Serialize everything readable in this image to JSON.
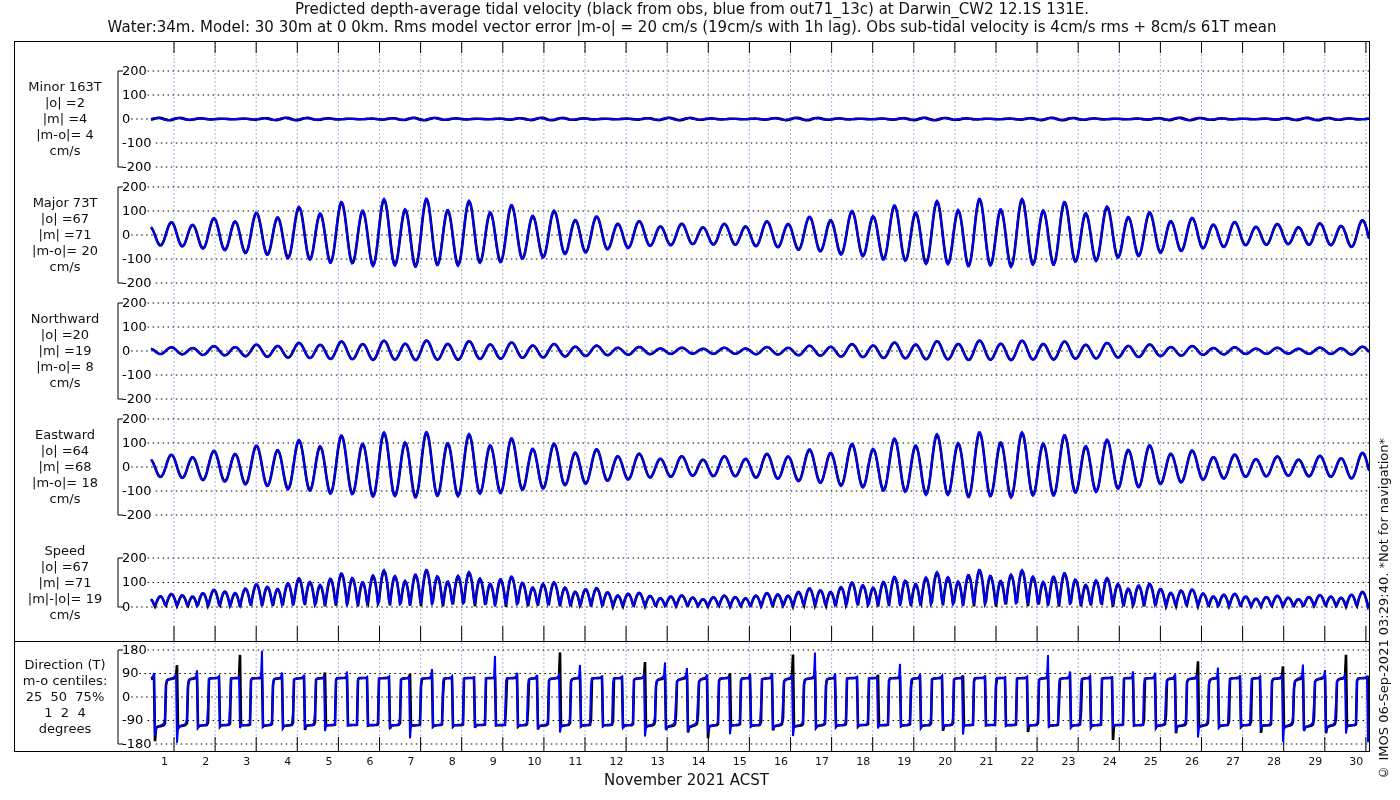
{
  "title": [
    "Predicted depth-average tidal velocity (black from obs, blue from out71_13c) at Darwin_CW2 12.1S 131E.",
    "Water:34m. Model: 30 30m at 0 0km. Rms model vector error |m-o| = 20 cm/s (19cm/s with 1h lag). Obs sub-tidal velocity is 4cm/s rms + 8cm/s 61T mean"
  ],
  "panels": [
    {
      "kind": "velocity",
      "label": [
        "Minor 163T",
        "|o| =2",
        "|m| =4",
        "|m-o|= 4",
        "cm/s"
      ],
      "yticks": [
        "200",
        "100",
        "0",
        "-100",
        "-200"
      ]
    },
    {
      "kind": "velocity",
      "label": [
        "Major 73T",
        "|o| =67",
        "|m| =71",
        "|m-o|= 20",
        "cm/s"
      ],
      "yticks": [
        "200",
        "100",
        "0",
        "-100",
        "-200"
      ]
    },
    {
      "kind": "velocity",
      "label": [
        "Northward",
        "|o| =20",
        "|m| =19",
        "|m-o|= 8",
        "cm/s"
      ],
      "yticks": [
        "200",
        "100",
        "0",
        "-100",
        "-200"
      ]
    },
    {
      "kind": "velocity",
      "label": [
        "Eastward",
        "|o| =64",
        "|m| =68",
        "|m-o|= 18",
        "cm/s"
      ],
      "yticks": [
        "200",
        "100",
        "0",
        "-100",
        "-200"
      ]
    },
    {
      "kind": "speed",
      "label": [
        "Speed",
        "|o| =67",
        "|m| =71",
        "|m|-|o|= 19",
        "cm/s"
      ],
      "yticks": [
        "200",
        "100",
        "0"
      ]
    },
    {
      "kind": "direction",
      "label": [
        "Direction (T)",
        "m-o centiles:",
        "25  50  75%",
        "1  2  4",
        "degrees"
      ],
      "yticks": [
        "180",
        "90",
        "0",
        "-90",
        "-180"
      ]
    }
  ],
  "x_axis": {
    "ticks": [
      "1",
      "2",
      "3",
      "4",
      "5",
      "6",
      "7",
      "8",
      "9",
      "10",
      "11",
      "12",
      "13",
      "14",
      "15",
      "16",
      "17",
      "18",
      "19",
      "20",
      "21",
      "22",
      "23",
      "24",
      "25",
      "26",
      "27",
      "28",
      "29",
      "30"
    ],
    "label": "November 2021 ACST"
  },
  "side_note": "© IMOS 06-Sep-2021 03:29:40. *Not for navigation*"
}
